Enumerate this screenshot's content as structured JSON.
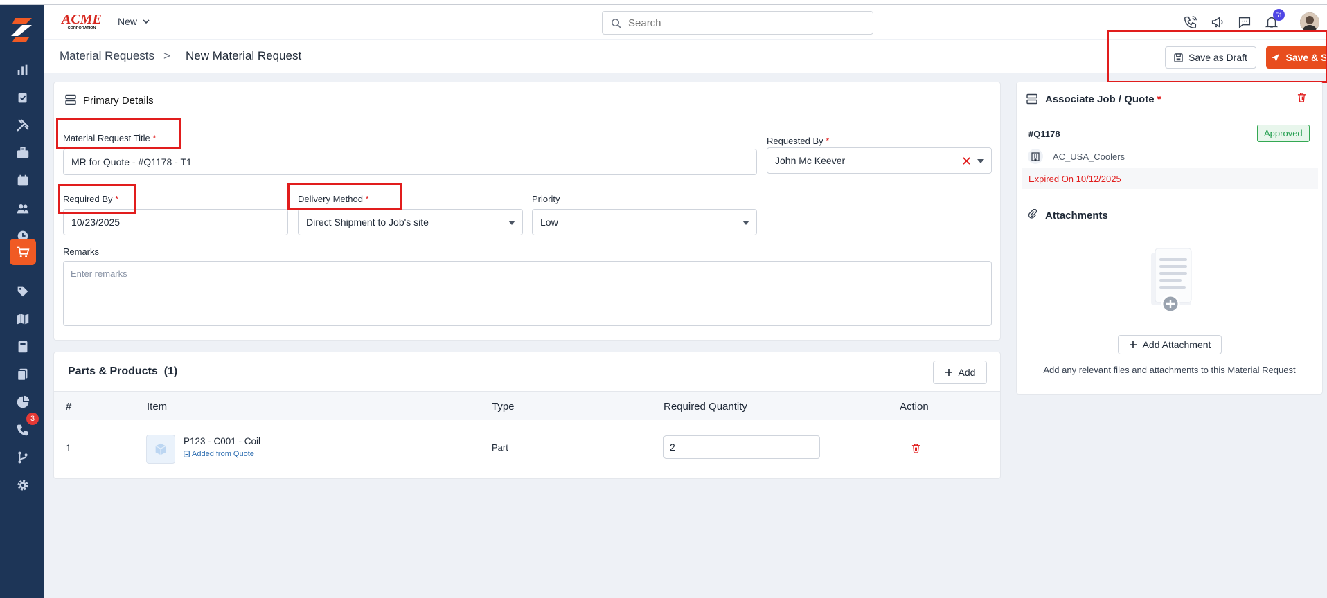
{
  "colors": {
    "sidebar_bg": "#1d3557",
    "accent": "#e84d1e",
    "danger": "#e11d1d",
    "success": "#1f9d4c",
    "link": "#2b6cb0"
  },
  "sidebar": {
    "items": [
      {
        "icon": "bar-chart-icon"
      },
      {
        "icon": "clipboard-check-icon"
      },
      {
        "icon": "tools-icon"
      },
      {
        "icon": "briefcase-icon"
      },
      {
        "icon": "calendar-icon"
      },
      {
        "icon": "users-icon"
      },
      {
        "icon": "clock-icon"
      },
      {
        "icon": "cart-icon",
        "active": true
      },
      {
        "icon": "tag-icon"
      },
      {
        "icon": "map-icon"
      },
      {
        "icon": "calculator-icon"
      },
      {
        "icon": "documents-icon"
      },
      {
        "icon": "pie-chart-icon"
      },
      {
        "icon": "phone-icon",
        "badge": "3"
      },
      {
        "icon": "workflow-icon"
      },
      {
        "icon": "gear-icon"
      }
    ]
  },
  "header": {
    "brand_top": "ACME",
    "brand_bottom": "CORPORATION",
    "new_label": "New",
    "search_placeholder": "Search",
    "notification_count": "51"
  },
  "breadcrumb": {
    "parent": "Material Requests",
    "separator": ">",
    "current": "New Material Request"
  },
  "actions": {
    "draft_label": "Save as Draft",
    "submit_label": "Save & Submit"
  },
  "primary": {
    "title": "Primary Details",
    "title_label": "Material Request Title",
    "title_value": "MR for Quote - #Q1178 - T1",
    "requested_by_label": "Requested By",
    "requested_by_value": "John Mc Keever",
    "required_by_label": "Required By",
    "required_by_value": "10/23/2025",
    "delivery_label": "Delivery Method",
    "delivery_value": "Direct Shipment to Job's site",
    "priority_label": "Priority",
    "priority_value": "Low",
    "remarks_label": "Remarks",
    "remarks_placeholder": "Enter remarks",
    "required_marker": "*"
  },
  "parts": {
    "title": "Parts & Products",
    "count": "(1)",
    "add_label": "Add",
    "columns": [
      "#",
      "Item",
      "Type",
      "Required Quantity",
      "Action"
    ],
    "rows": [
      {
        "index": "1",
        "item": "P123 - C001 - Coil",
        "source": "Added from Quote",
        "type": "Part",
        "quantity": "2"
      }
    ]
  },
  "associate": {
    "title": "Associate Job / Quote",
    "quote_id": "#Q1178",
    "status": "Approved",
    "company": "AC_USA_Coolers",
    "expiry": "Expired On 10/12/2025"
  },
  "attachments": {
    "title": "Attachments",
    "add_label": "Add Attachment",
    "hint": "Add any relevant files and attachments to this Material Request"
  }
}
